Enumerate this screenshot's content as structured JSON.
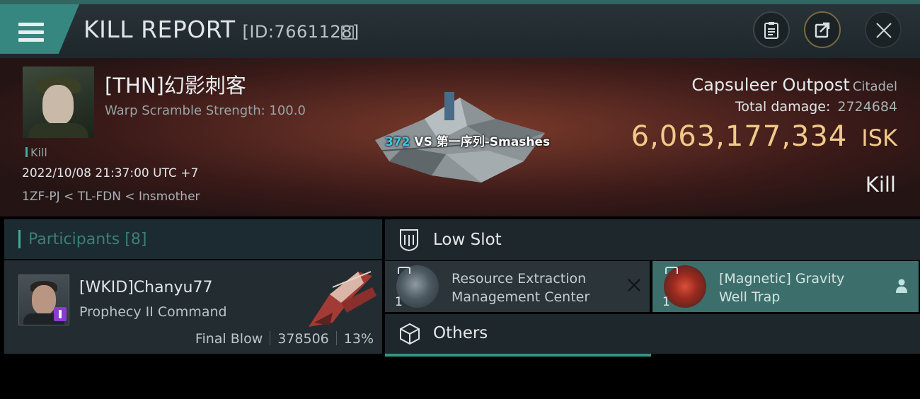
{
  "header": {
    "title": "KILL REPORT",
    "report_id": "[ID:7661128]"
  },
  "victim": {
    "name": "[THN]幻影刺客",
    "warp_text": "Warp Scramble Strength: 100.0",
    "kill_tag": "Kill",
    "time": "2022/10/08 21:37:00 UTC +7",
    "location": "1ZF-PJ < TL-FDN < Insmother"
  },
  "versus": {
    "count": "372",
    "text": "VS 第一序列-Smashes"
  },
  "target": {
    "type": "Capsuleer Outpost",
    "subtype": "Citadel",
    "damage_label": "Total damage:",
    "damage_value": "2724684",
    "isk_value": "6,063,177,334",
    "isk_unit": "ISK",
    "result": "Kill"
  },
  "participants": {
    "title": "Participants",
    "count": "[8]",
    "items": [
      {
        "name": "[WKID]Chanyu77",
        "ship": "Prophecy II Command",
        "role": "Final Blow",
        "damage": "378506",
        "percent": "13%"
      }
    ]
  },
  "slots": {
    "low_slot_title": "Low Slot",
    "items": [
      {
        "qty": "1",
        "name_line1": "Resource Extraction",
        "name_line2": "Management Center",
        "status_icon": "close-icon"
      },
      {
        "qty": "1",
        "name_line1": "[Magnetic] Gravity",
        "name_line2": "Well Trap",
        "status_icon": "person-icon"
      }
    ],
    "others_title": "Others"
  },
  "colors": {
    "accent": "#3fae9d",
    "isk": "#f1c98a",
    "menu_tab": "#35877f",
    "selected_slot": "#3c6f6b",
    "versus_count": "#39c7e6"
  }
}
